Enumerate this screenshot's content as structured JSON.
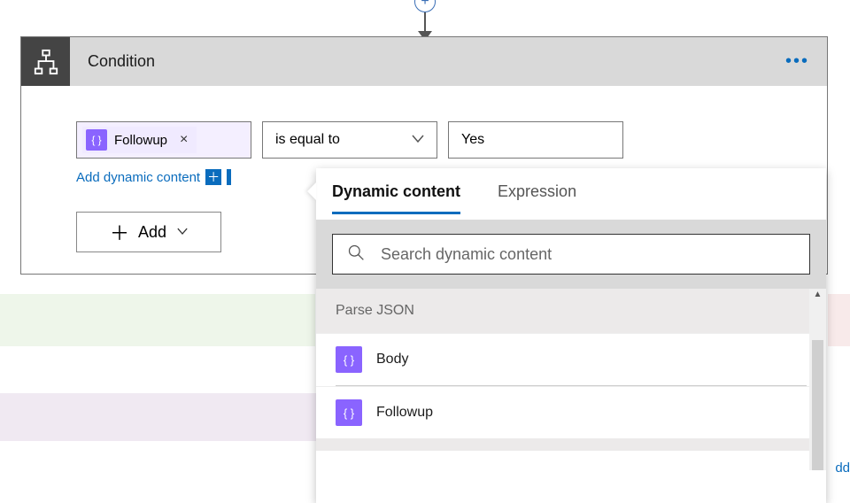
{
  "header": {
    "title": "Condition"
  },
  "condition": {
    "token": "Followup",
    "operator": "is equal to",
    "value": "Yes",
    "add_dynamic_link": "Add dynamic content",
    "add_button": "Add"
  },
  "popup": {
    "tabs": {
      "dynamic": "Dynamic content",
      "expression": "Expression"
    },
    "search_placeholder": "Search dynamic content",
    "section_title": "Parse JSON",
    "items": [
      "Body",
      "Followup"
    ]
  },
  "truncated_link": "dd"
}
